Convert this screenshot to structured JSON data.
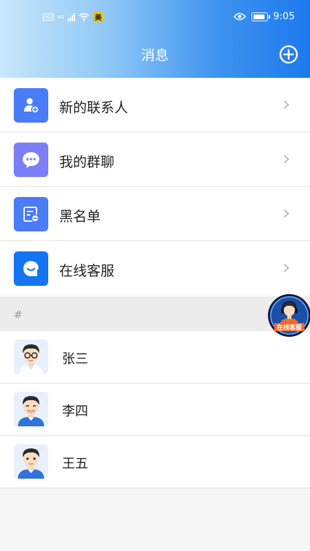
{
  "status_bar": {
    "hd": "HD",
    "network": "4G",
    "app_badge": "美",
    "time": "9:05"
  },
  "header": {
    "title": "消息"
  },
  "menu": {
    "items": [
      {
        "label": "新的联系人",
        "icon": "add-contact-icon",
        "color": "#4a7cf7"
      },
      {
        "label": "我的群聊",
        "icon": "chat-bubble-icon",
        "color": "#7b7ff5"
      },
      {
        "label": "黑名单",
        "icon": "blacklist-icon",
        "color": "#4a7cf7"
      },
      {
        "label": "在线客服",
        "icon": "service-icon",
        "color": "#1574f2"
      }
    ]
  },
  "section": {
    "label": "#"
  },
  "contacts": [
    {
      "name": "张三",
      "avatar": "avatar-glasses"
    },
    {
      "name": "李四",
      "avatar": "avatar-smile"
    },
    {
      "name": "王五",
      "avatar": "avatar-neutral"
    }
  ],
  "floating_service": {
    "label": "在线客服"
  },
  "colors": {
    "accent": "#1d79ee",
    "background": "#f6f6f6"
  }
}
